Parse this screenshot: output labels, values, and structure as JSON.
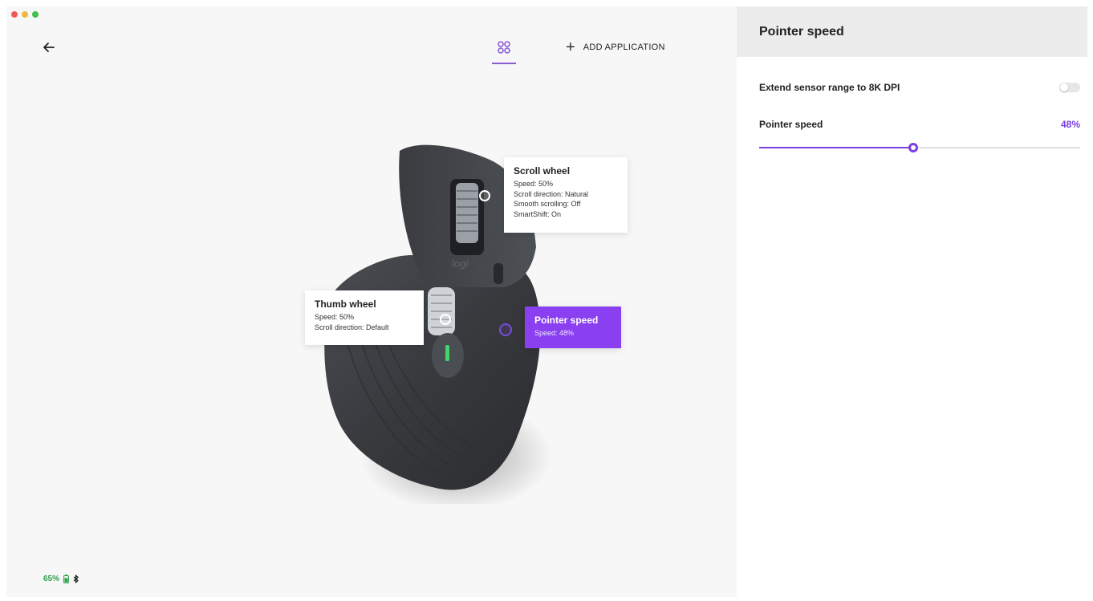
{
  "header": {
    "add_application_label": "ADD APPLICATION"
  },
  "callouts": {
    "scroll_wheel": {
      "title": "Scroll wheel",
      "lines": [
        "Speed: 50%",
        "Scroll direction: Natural",
        "Smooth scrolling: Off",
        "SmartShift: On"
      ]
    },
    "thumb_wheel": {
      "title": "Thumb wheel",
      "lines": [
        "Speed: 50%",
        "Scroll direction: Default"
      ]
    },
    "pointer_speed": {
      "title": "Pointer speed",
      "lines": [
        "Speed: 48%"
      ]
    }
  },
  "battery": {
    "percent": "65%"
  },
  "panel": {
    "title": "Pointer speed",
    "extend_label": "Extend sensor range to 8K DPI",
    "extend_on": false,
    "speed_label": "Pointer speed",
    "speed_value": "48%",
    "speed_fraction": 0.48
  },
  "colors": {
    "accent": "#7b3fe4",
    "pointer_callout": "#8a3ff0",
    "battery_green": "#2e9e4a"
  },
  "icons": {
    "back": "arrow-left-icon",
    "device": "device-grid-icon",
    "add": "plus-icon",
    "battery": "battery-icon",
    "bluetooth": "bluetooth-icon"
  }
}
